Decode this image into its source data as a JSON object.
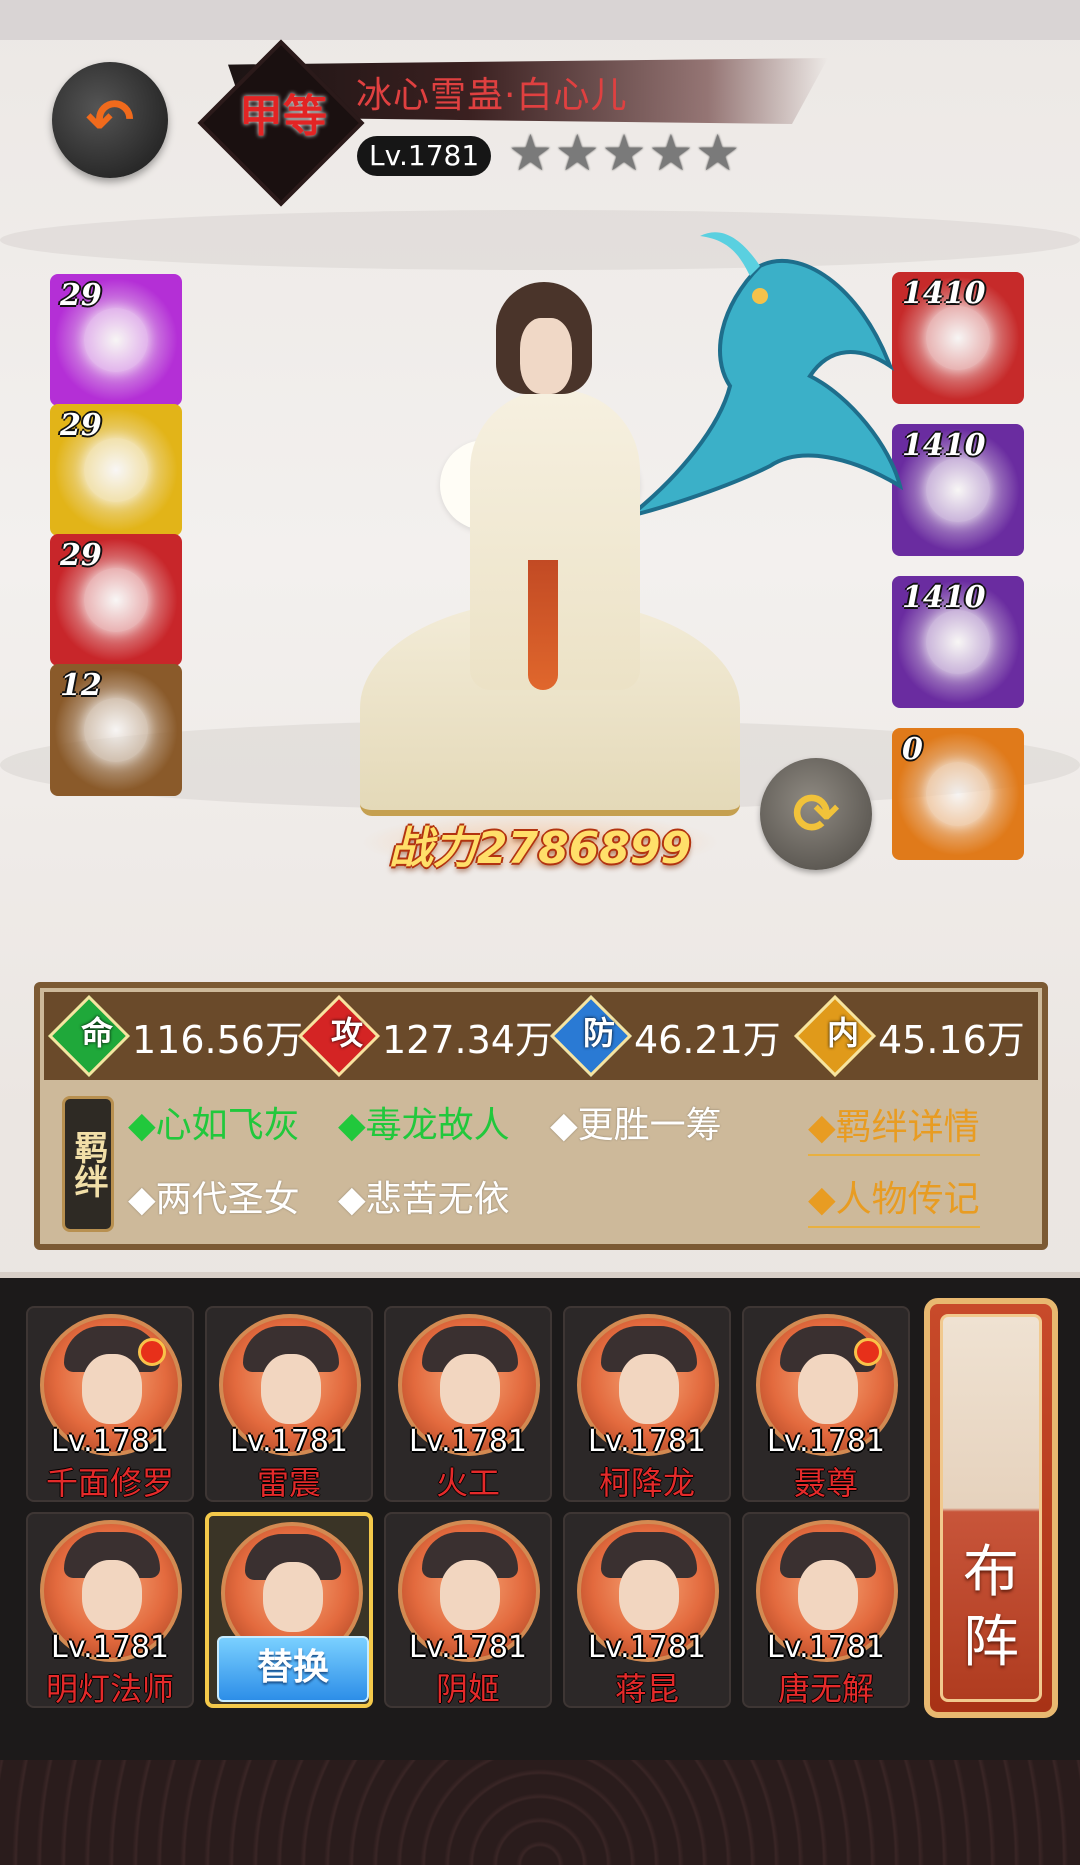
{
  "hero": {
    "grade": "甲等",
    "name": "冰心雪蛊·白心儿",
    "level": "Lv.1781",
    "stars": "★★★★★",
    "power": "战力2786899"
  },
  "left_slots": [
    {
      "count": "29",
      "icon": "heart-skill-icon",
      "color": "#b42fd6"
    },
    {
      "count": "29",
      "icon": "swirl-skill-icon",
      "color": "#e2b418"
    },
    {
      "count": "29",
      "icon": "buddha-skill-icon",
      "color": "#c8262a"
    },
    {
      "count": "12",
      "icon": "gem-orb-icon",
      "color": "#8a5a2a"
    }
  ],
  "right_slots": [
    {
      "count": "1410",
      "icon": "conch-icon",
      "color": "#c62a2a"
    },
    {
      "count": "1410",
      "icon": "cloak-icon",
      "color": "#6a2ca0"
    },
    {
      "count": "1410",
      "icon": "amulet-icon",
      "color": "#6a2ca0"
    },
    {
      "count": "0",
      "icon": "thunder-bird-icon",
      "color": "#e07a1a"
    }
  ],
  "stats": [
    {
      "label": "命",
      "value": "116.56万",
      "color": "#1fa83a"
    },
    {
      "label": "攻",
      "value": "127.34万",
      "color": "#d42424"
    },
    {
      "label": "防",
      "value": "46.21万",
      "color": "#2a7ad4"
    },
    {
      "label": "内",
      "value": "45.16万",
      "color": "#e09a1a"
    }
  ],
  "bonds": {
    "tag": "羁绊",
    "row1": [
      {
        "text": "◆心如飞灰",
        "active": true
      },
      {
        "text": "◆毒龙故人",
        "active": true
      },
      {
        "text": "◆更胜一筹",
        "active": false
      }
    ],
    "row2": [
      {
        "text": "◆两代圣女",
        "active": false
      },
      {
        "text": "◆悲苦无依",
        "active": false
      }
    ],
    "link1": "◆羁绊详情",
    "link2": "◆人物传记"
  },
  "roster": [
    {
      "level": "Lv.1781",
      "name": "千面修罗",
      "dot": true
    },
    {
      "level": "Lv.1781",
      "name": "雷震",
      "dot": false
    },
    {
      "level": "Lv.1781",
      "name": "火工",
      "dot": false
    },
    {
      "level": "Lv.1781",
      "name": "柯降龙",
      "dot": false
    },
    {
      "level": "Lv.1781",
      "name": "聂尊",
      "dot": true
    },
    {
      "level": "Lv.1781",
      "name": "明灯法师",
      "dot": false
    },
    {
      "level": "",
      "name": "",
      "dot": false,
      "selected": true,
      "action": "替换"
    },
    {
      "level": "Lv.1781",
      "name": "阴姬",
      "dot": false
    },
    {
      "level": "Lv.1781",
      "name": "蒋昆",
      "dot": false
    },
    {
      "level": "Lv.1781",
      "name": "唐无解",
      "dot": false
    }
  ],
  "formation_button": "布阵",
  "back_icon": "back-arrow-icon",
  "swap_icon": "swap-icon"
}
